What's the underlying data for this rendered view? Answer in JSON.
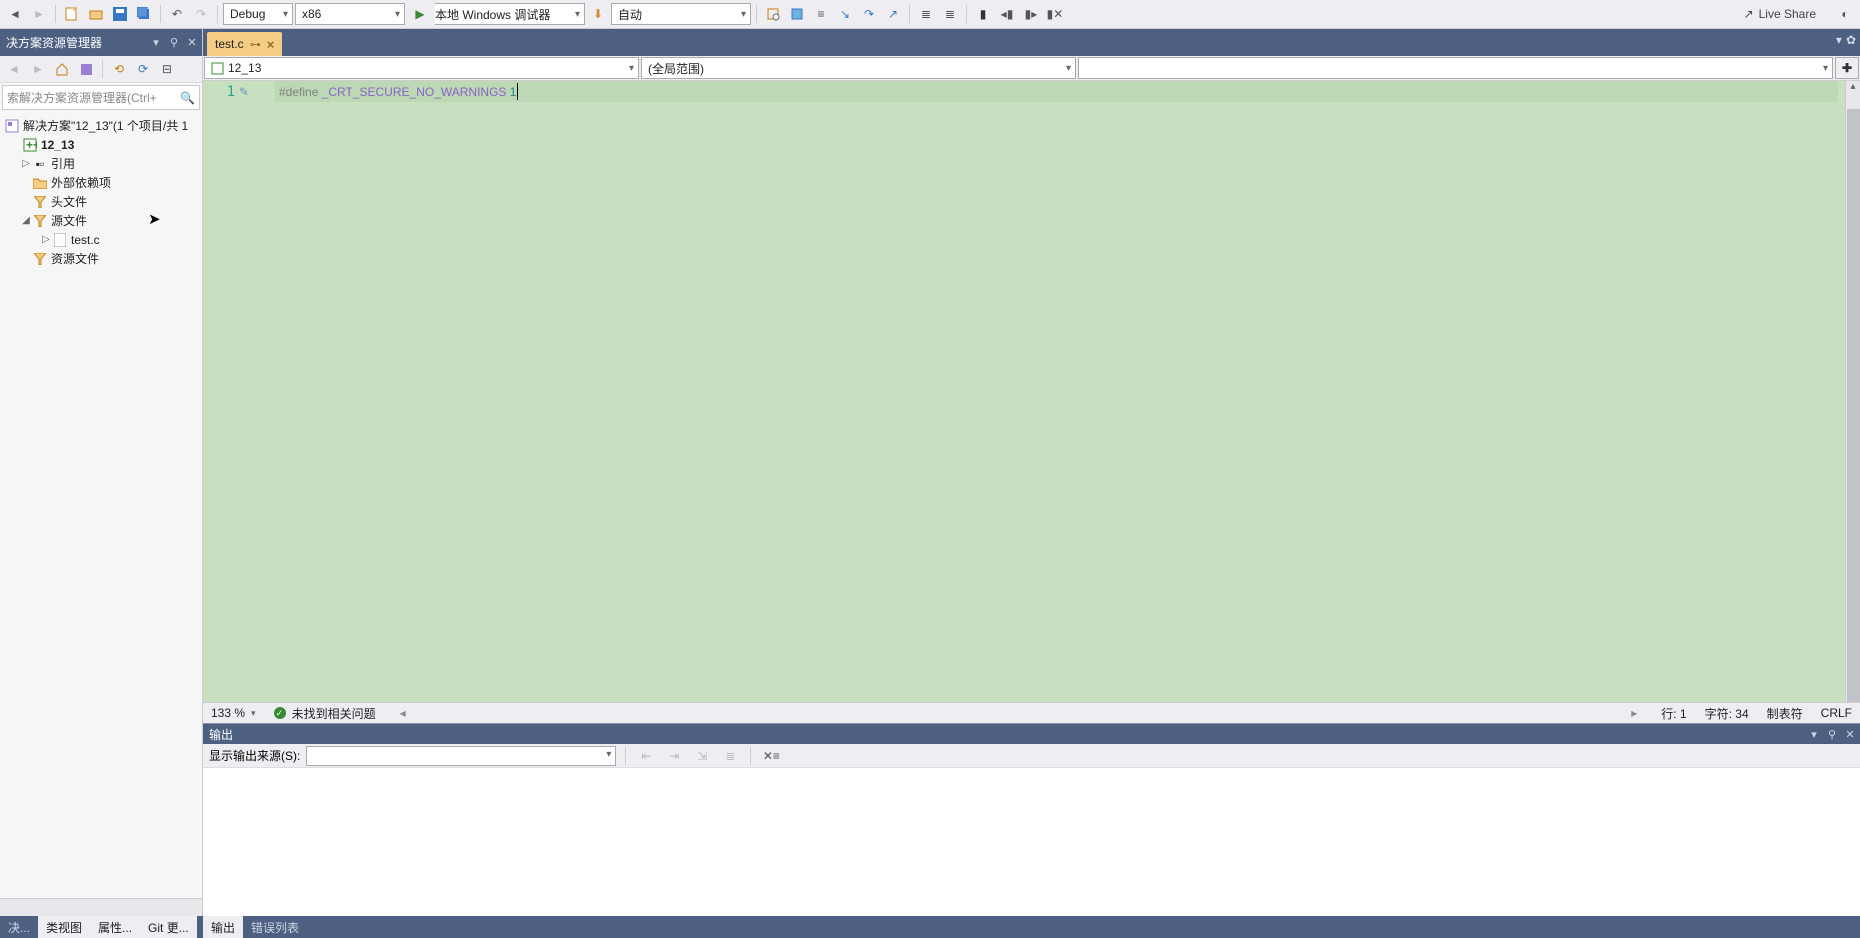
{
  "toolbar": {
    "config": "Debug",
    "platform": "x86",
    "debugger": "本地 Windows 调试器",
    "auto": "自动",
    "liveshare": "Live Share"
  },
  "solution_explorer": {
    "title": "决方案资源管理器",
    "search_placeholder": "索解决方案资源管理器(Ctrl+",
    "solution_label": "解决方案\"12_13\"(1 个项目/共 1",
    "project": "12_13",
    "nodes": {
      "refs": "引用",
      "ext": "外部依赖项",
      "headers": "头文件",
      "sources": "源文件",
      "src_file": "test.c",
      "resources": "资源文件"
    }
  },
  "editor": {
    "tab_name": "test.c",
    "nav_project": "12_13",
    "nav_scope": "(全局范围)",
    "code": {
      "line_no": "1",
      "kw": "#define",
      "macro": "_CRT_SECURE_NO_WARNINGS",
      "val": "1"
    },
    "status": {
      "zoom": "133 %",
      "issues": "未找到相关问题",
      "line": "行: 1",
      "char": "字符: 34",
      "tab": "制表符",
      "eol": "CRLF"
    }
  },
  "output": {
    "title": "输出",
    "source_label": "显示输出来源(S):"
  },
  "bottom_tabs": {
    "left_prefix": "决...",
    "left1": "类视图",
    "left2": "属性...",
    "left3": "Git 更...",
    "right_active": "输出",
    "right2": "错误列表"
  }
}
